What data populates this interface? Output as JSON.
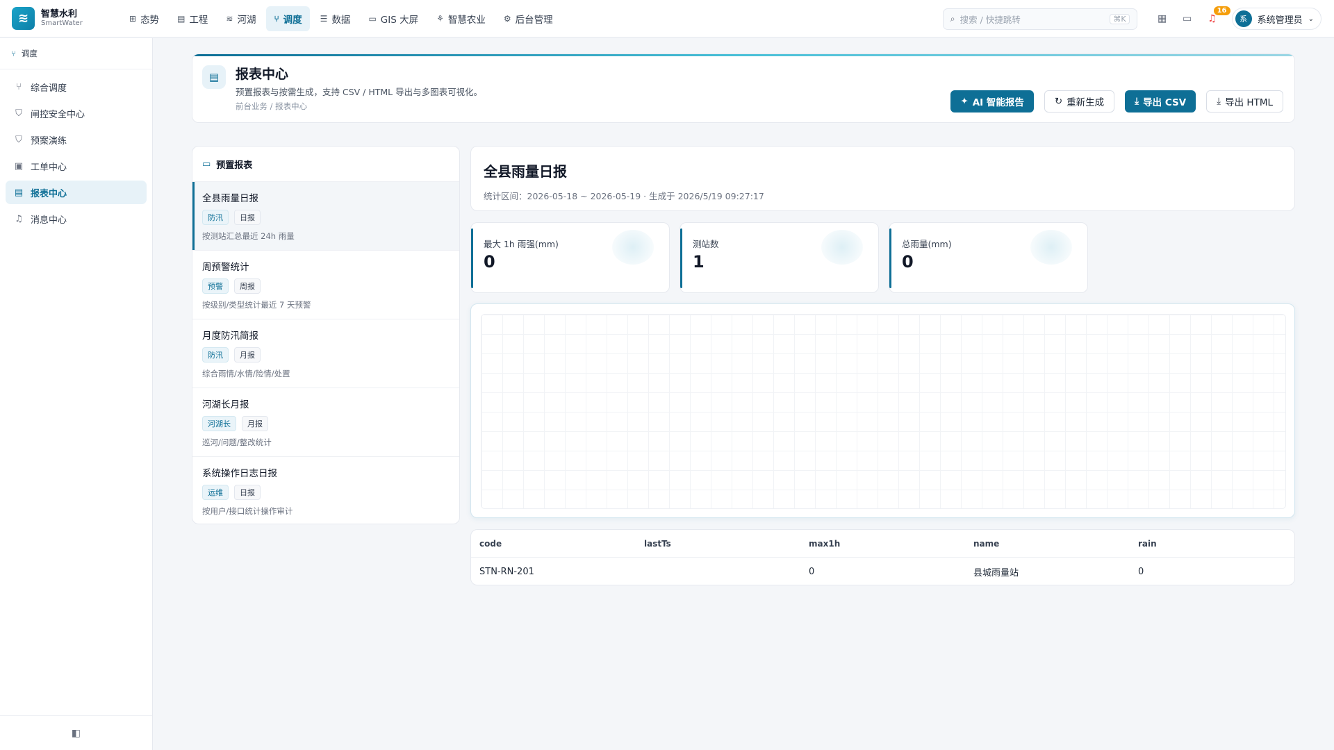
{
  "brand": {
    "name": "智慧水利",
    "sub": "SmartWater",
    "logo": "≋"
  },
  "nav": [
    {
      "label": "态势",
      "icon": "grid-icon",
      "glyph": "⊞"
    },
    {
      "label": "工程",
      "icon": "building-icon",
      "glyph": "▤"
    },
    {
      "label": "河湖",
      "icon": "waves-icon",
      "glyph": "≋"
    },
    {
      "label": "调度",
      "icon": "branch-icon",
      "glyph": "⑂",
      "active": true
    },
    {
      "label": "数据",
      "icon": "database-icon",
      "glyph": "☰"
    },
    {
      "label": "GIS 大屏",
      "icon": "monitor-icon",
      "glyph": "▭"
    },
    {
      "label": "智慧农业",
      "icon": "sprout-icon",
      "glyph": "⚘"
    },
    {
      "label": "后台管理",
      "icon": "gear-icon",
      "glyph": "⚙"
    }
  ],
  "search": {
    "placeholder": "搜索 / 快捷跳转",
    "shortcut": "⌘K"
  },
  "notifications": {
    "count": "16"
  },
  "user": {
    "avatar": "系",
    "name": "系统管理员"
  },
  "sidebar": {
    "section": "调度",
    "items": [
      {
        "label": "综合调度",
        "glyph": "⑂"
      },
      {
        "label": "闸控安全中心",
        "glyph": "⛉"
      },
      {
        "label": "预案演练",
        "glyph": "⛉"
      },
      {
        "label": "工单中心",
        "glyph": "▣"
      },
      {
        "label": "报表中心",
        "glyph": "▤",
        "active": true
      },
      {
        "label": "消息中心",
        "glyph": "♫"
      }
    ]
  },
  "page": {
    "title": "报表中心",
    "description": "预置报表与按需生成，支持 CSV / HTML 导出与多图表可视化。",
    "breadcrumb": "前台业务 / 报表中心",
    "actions": {
      "ai_report": "AI 智能报告",
      "regenerate": "重新生成",
      "export_csv": "导出 CSV",
      "export_html": "导出 HTML"
    }
  },
  "presets": {
    "title": "预置报表",
    "items": [
      {
        "title": "全县雨量日报",
        "tags": [
          "防汛",
          "日报"
        ],
        "desc": "按测站汇总最近 24h 雨量",
        "active": true
      },
      {
        "title": "周预警统计",
        "tags": [
          "预警",
          "周报"
        ],
        "desc": "按级别/类型统计最近 7 天预警"
      },
      {
        "title": "月度防汛简报",
        "tags": [
          "防汛",
          "月报"
        ],
        "desc": "综合雨情/水情/险情/处置"
      },
      {
        "title": "河湖长月报",
        "tags": [
          "河湖长",
          "月报"
        ],
        "desc": "巡河/问题/整改统计"
      },
      {
        "title": "系统操作日志日报",
        "tags": [
          "运维",
          "日报"
        ],
        "desc": "按用户/接口统计操作审计"
      }
    ]
  },
  "report": {
    "title": "全县雨量日报",
    "meta": "统计区间：2026-05-18 ~ 2026-05-19 · 生成于 2026/5/19 09:27:17",
    "stats": [
      {
        "label": "最大 1h 雨强(mm)",
        "value": "0"
      },
      {
        "label": "测站数",
        "value": "1"
      },
      {
        "label": "总雨量(mm)",
        "value": "0"
      }
    ],
    "table": {
      "columns": [
        "code",
        "lastTs",
        "max1h",
        "name",
        "rain"
      ],
      "rows": [
        [
          "STN-RN-201",
          "",
          "0",
          "县城雨量站",
          "0"
        ]
      ]
    }
  },
  "colors": {
    "accent": "#0e6f96",
    "accent_light": "#e7f2f8"
  }
}
